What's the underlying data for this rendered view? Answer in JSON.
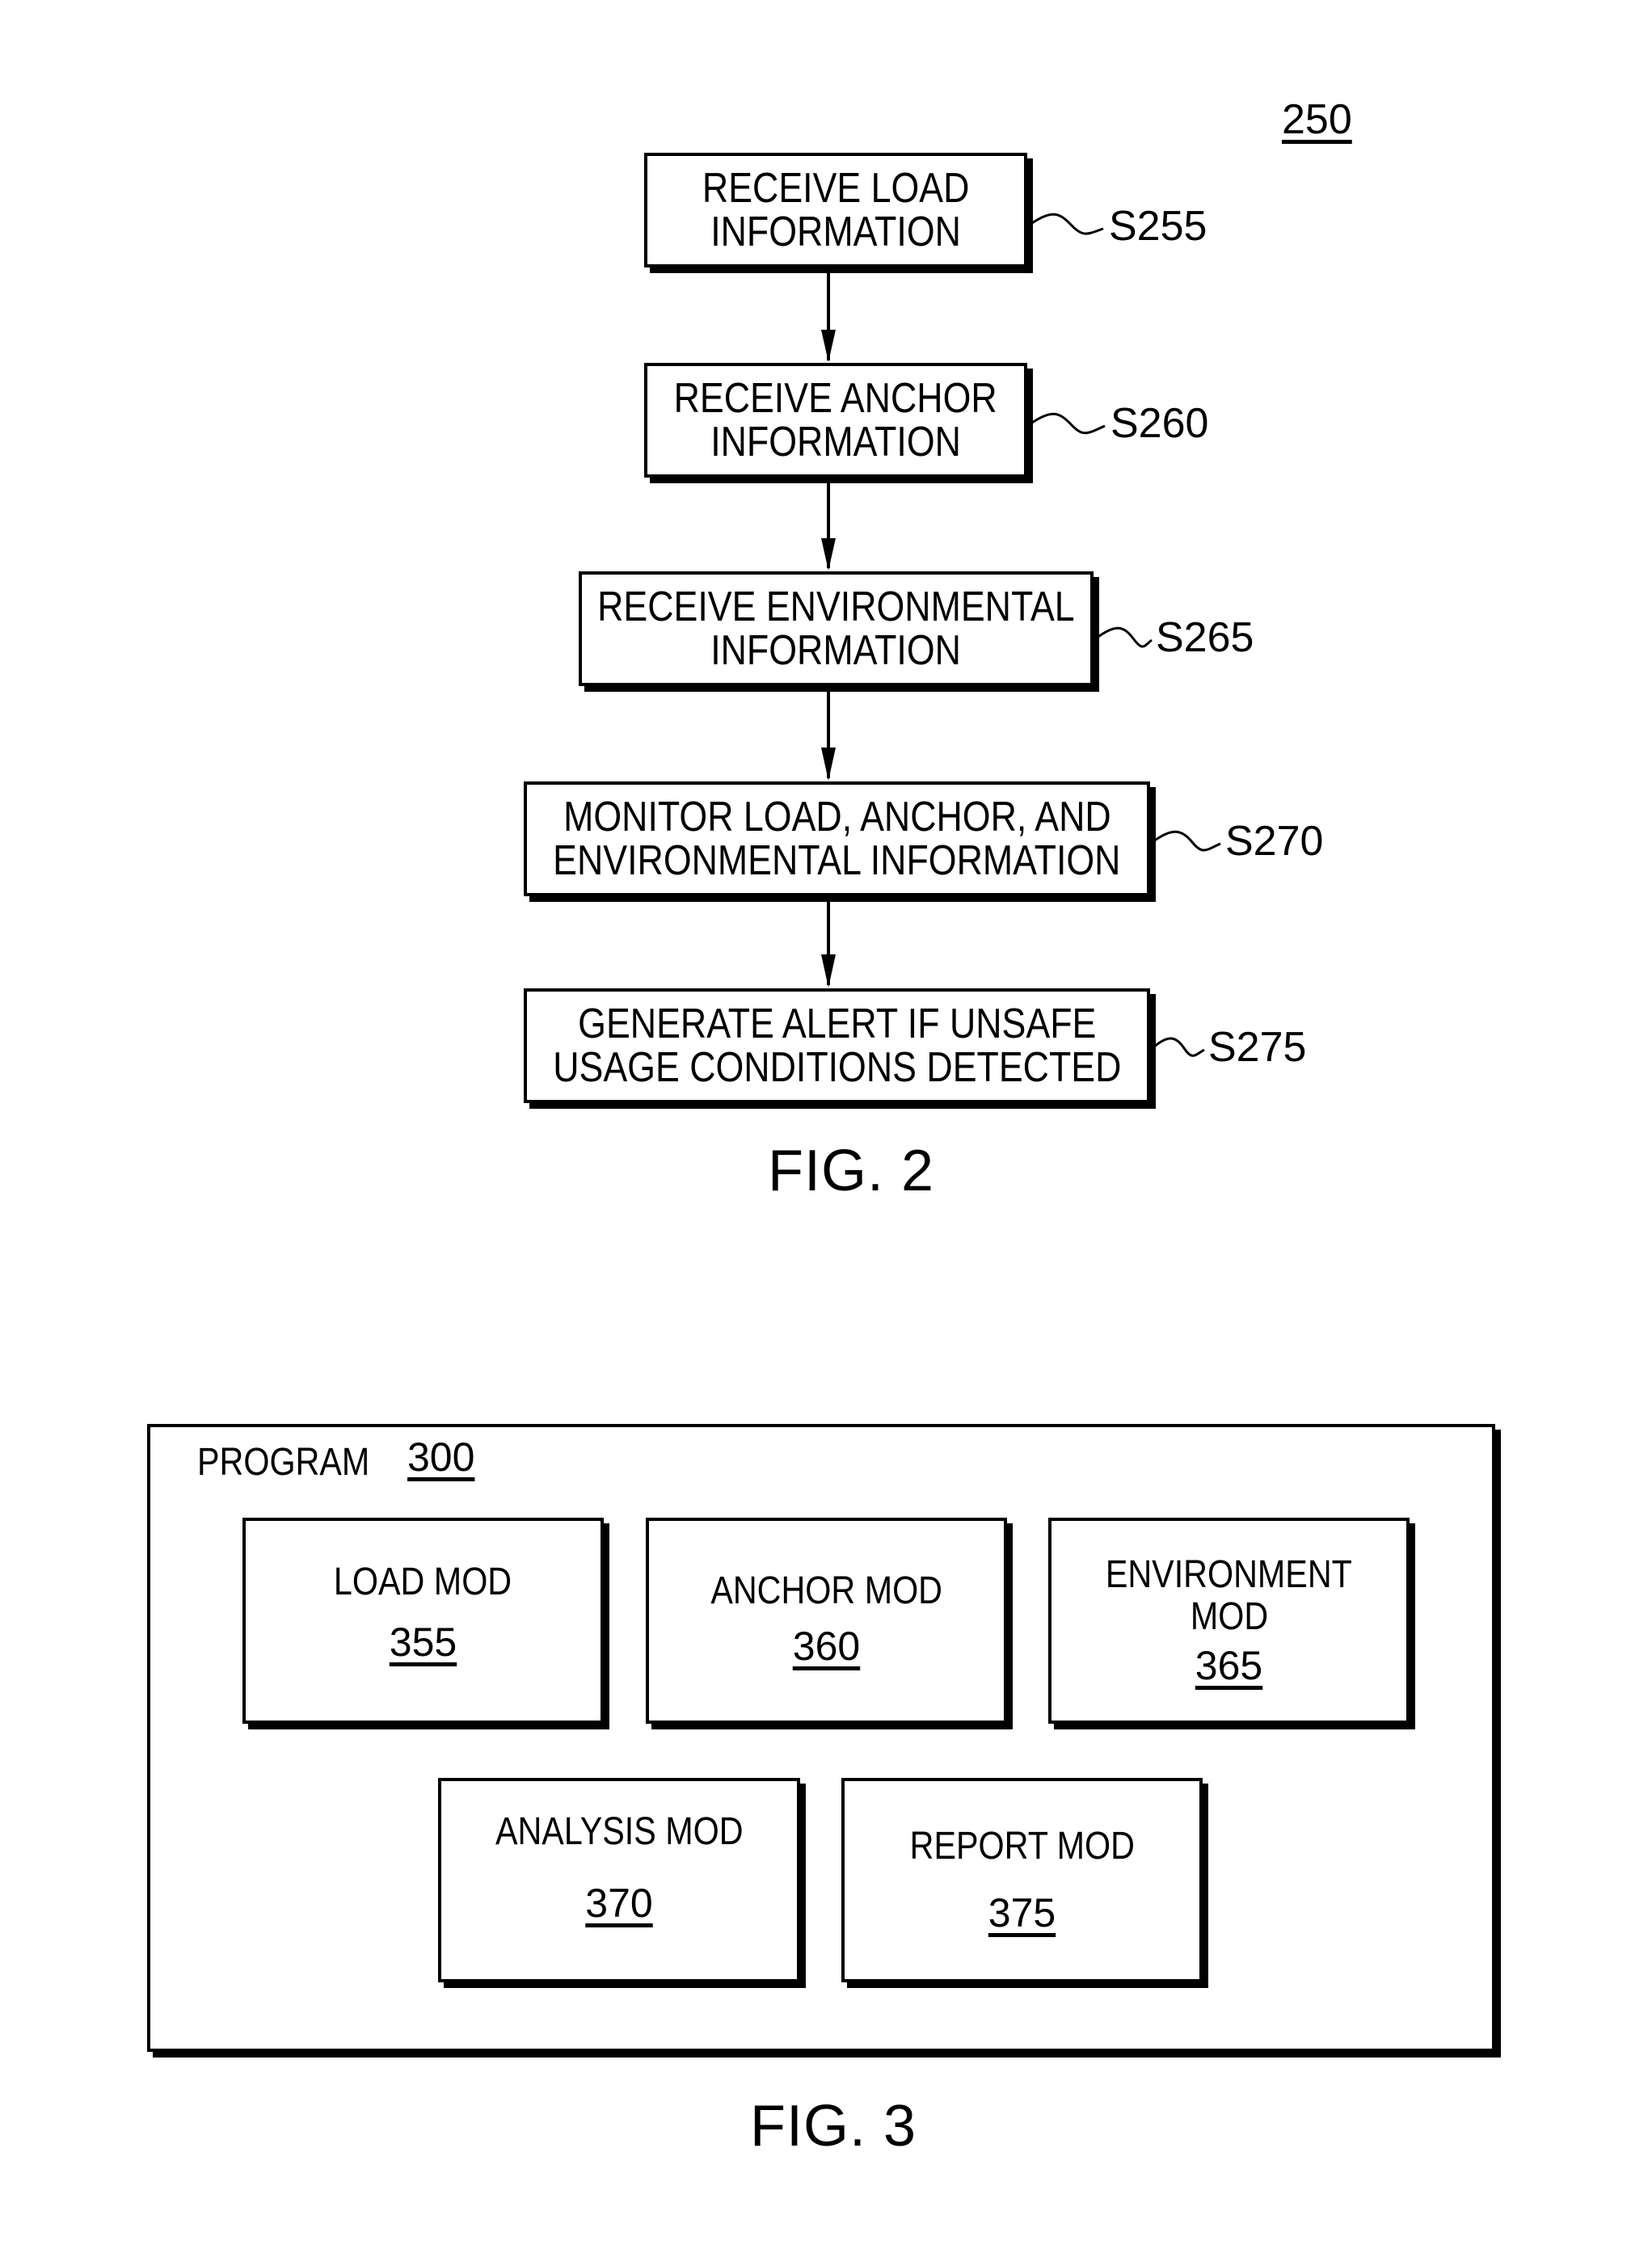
{
  "fig2": {
    "reference_number": "250",
    "caption": "FIG. 2",
    "steps": [
      {
        "id": "S255",
        "line1": "RECEIVE LOAD",
        "line2": "INFORMATION"
      },
      {
        "id": "S260",
        "line1": "RECEIVE ANCHOR",
        "line2": "INFORMATION"
      },
      {
        "id": "S265",
        "line1": "RECEIVE ENVIRONMENTAL",
        "line2": "INFORMATION"
      },
      {
        "id": "S270",
        "line1": "MONITOR LOAD, ANCHOR, AND",
        "line2": "ENVIRONMENTAL INFORMATION"
      },
      {
        "id": "S275",
        "line1": "GENERATE ALERT IF UNSAFE",
        "line2": "USAGE CONDITIONS DETECTED"
      }
    ]
  },
  "fig3": {
    "caption": "FIG. 3",
    "program_label": "PROGRAM",
    "program_number": "300",
    "modules": [
      {
        "title_line1": "LOAD MOD",
        "title_line2": "",
        "number": "355"
      },
      {
        "title_line1": "ANCHOR MOD",
        "title_line2": "",
        "number": "360"
      },
      {
        "title_line1": "ENVIRONMENT",
        "title_line2": "MOD",
        "number": "365"
      },
      {
        "title_line1": "ANALYSIS MOD",
        "title_line2": "",
        "number": "370"
      },
      {
        "title_line1": "REPORT MOD",
        "title_line2": "",
        "number": "375"
      }
    ]
  }
}
